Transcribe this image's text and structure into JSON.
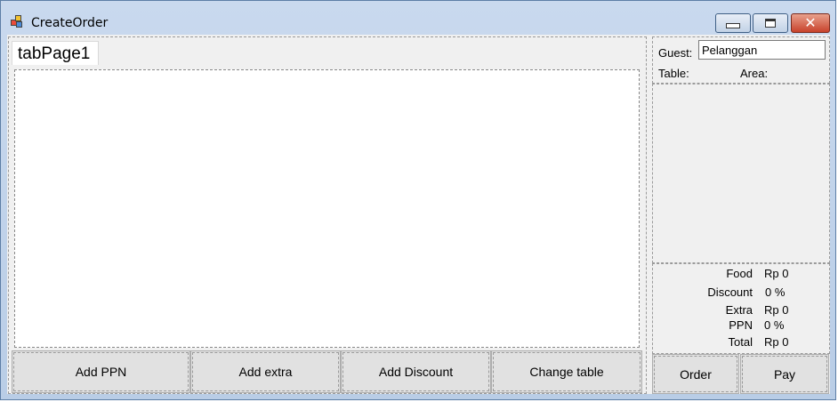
{
  "window": {
    "title": "CreateOrder",
    "close_glyph": "✕"
  },
  "tabs": [
    {
      "label": "tabPage1"
    }
  ],
  "bottom_buttons": [
    {
      "label": "Add PPN"
    },
    {
      "label": "Add extra"
    },
    {
      "label": "Add Discount"
    },
    {
      "label": "Change table"
    }
  ],
  "side": {
    "guest_label": "Guest:",
    "guest_value": "Pelanggan",
    "table_label": "Table:",
    "area_label": "Area:"
  },
  "summary": [
    {
      "label": "Food",
      "value": "Rp 0"
    },
    {
      "label": "Discount",
      "value": "0 %"
    },
    {
      "label": "Extra",
      "value": "Rp 0"
    },
    {
      "label": "PPN",
      "value": "0 %"
    },
    {
      "label": "Total",
      "value": "Rp 0"
    }
  ],
  "actions": {
    "order": "Order",
    "pay": "Pay"
  }
}
